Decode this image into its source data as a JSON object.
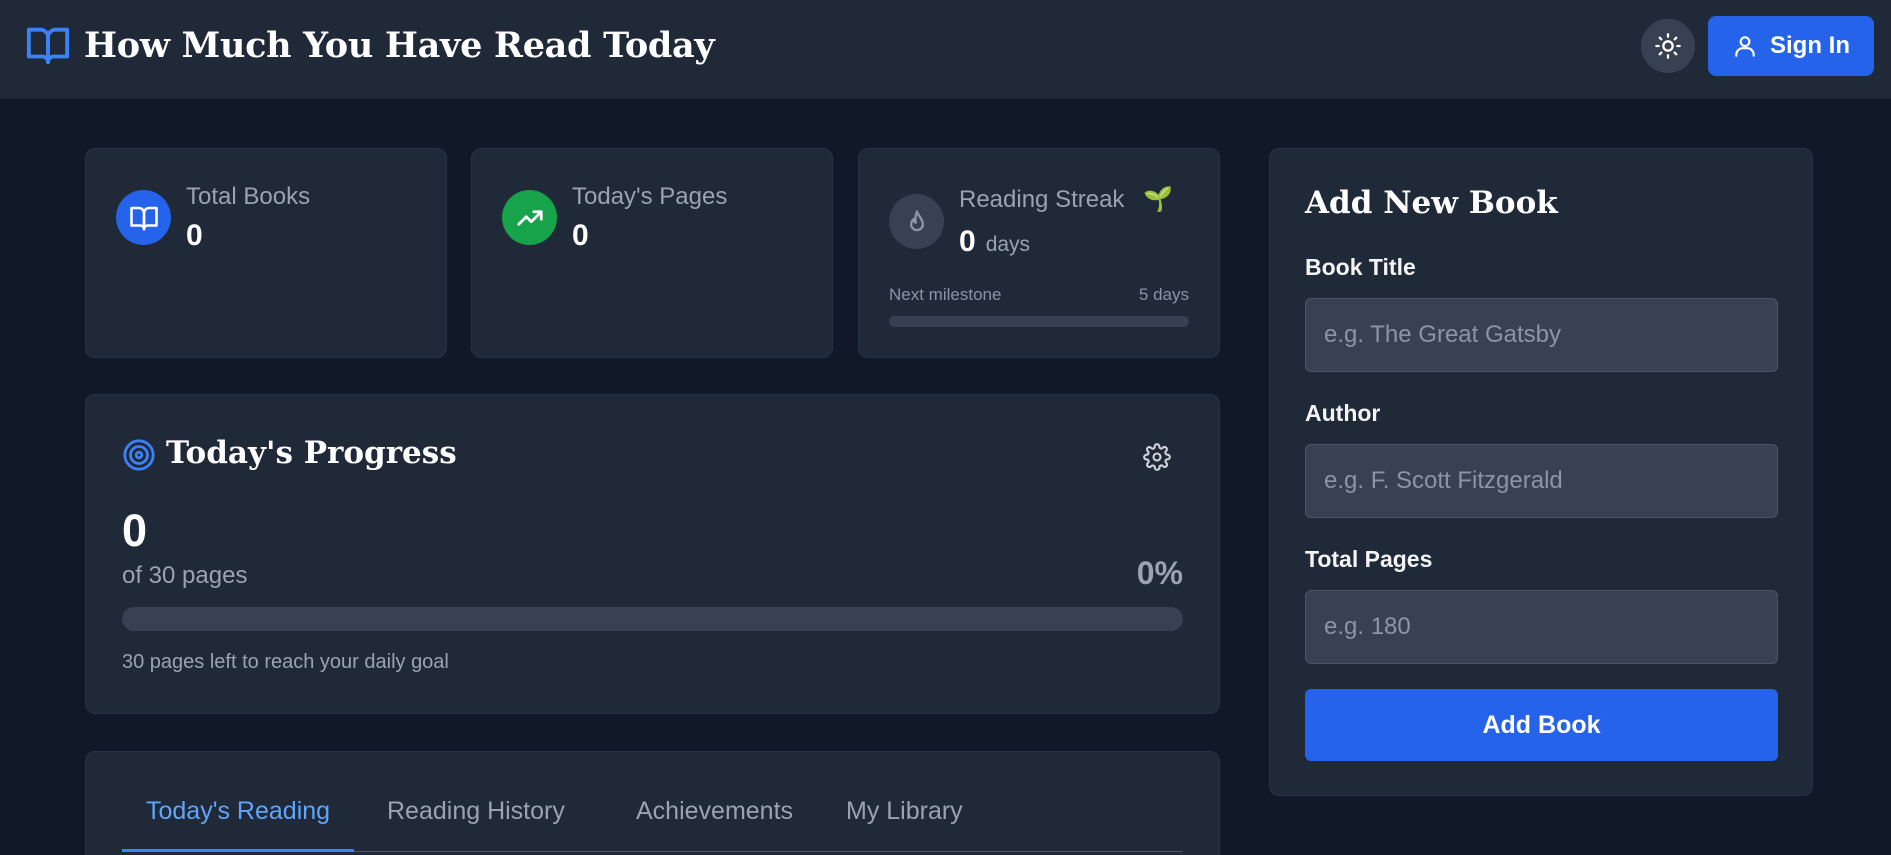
{
  "header": {
    "title": "How Much You Have Read Today",
    "sign_in_label": "Sign In",
    "accent": "#2563eb"
  },
  "stats": {
    "total_books": {
      "label": "Total Books",
      "value": "0",
      "icon": "book-open-icon",
      "color": "#2563eb"
    },
    "todays_pages": {
      "label": "Today's Pages",
      "value": "0",
      "icon": "trending-up-icon",
      "color": "#16a34a"
    },
    "streak": {
      "label": "Reading Streak",
      "badge": "🌱",
      "value": "0",
      "unit": "days",
      "icon": "flame-icon",
      "milestone_label": "Next milestone",
      "milestone_value": "5 days",
      "milestone_progress": 0
    }
  },
  "progress": {
    "title": "Today's Progress",
    "pages_read": "0",
    "goal_text": "of 30 pages",
    "percent_text": "0%",
    "percent": 0,
    "note": "30 pages left to reach your daily goal"
  },
  "tabs": [
    {
      "label": "Today's Reading",
      "active": true
    },
    {
      "label": "Reading History",
      "active": false
    },
    {
      "label": "Achievements",
      "active": false
    },
    {
      "label": "My Library",
      "active": false
    }
  ],
  "form": {
    "title": "Add New Book",
    "book_title": {
      "label": "Book Title",
      "placeholder": "e.g. The Great Gatsby",
      "value": ""
    },
    "author": {
      "label": "Author",
      "placeholder": "e.g. F. Scott Fitzgerald",
      "value": ""
    },
    "total_pages": {
      "label": "Total Pages",
      "placeholder": "e.g. 180",
      "value": ""
    },
    "submit_label": "Add Book"
  }
}
